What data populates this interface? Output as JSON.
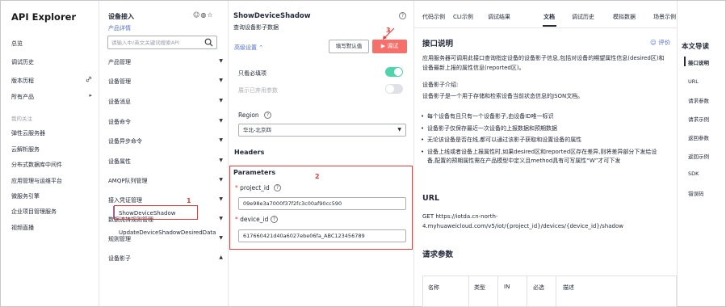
{
  "app": {
    "title": "API Explorer"
  },
  "left_nav": {
    "items": [
      {
        "label": "总览",
        "icon": ""
      },
      {
        "label": "调试历史",
        "icon": ""
      },
      {
        "label": "版本历程",
        "icon": "link-icon"
      },
      {
        "label": "所有产品",
        "icon": "chevron-right-icon"
      }
    ],
    "section_label": "我的关注",
    "followed": [
      "弹性云服务器",
      "云解析服务",
      "分布式数据库中间件",
      "应用管理与运维平台",
      "微服务引擎",
      "企业项目管理服务",
      "视频直播"
    ]
  },
  "api_list": {
    "title": "设备接入",
    "icons": [
      "smiley-icon",
      "globe-icon",
      "star-icon"
    ],
    "product_link": "产品详情",
    "search_placeholder": "请输入中/英文关键词搜索API",
    "groups": [
      "产品管理",
      "设备管理",
      "设备消息",
      "设备命令",
      "设备异步命令",
      "设备属性",
      "AMQP队列管理",
      "接入凭证管理",
      "数据流转规则管理",
      "规则管理",
      "设备影子"
    ],
    "sub_items": [
      "ShowDeviceShadow",
      "UpdateDeviceShadowDesiredData"
    ]
  },
  "debug_panel": {
    "api_name": "ShowDeviceShadow",
    "api_desc": "查询设备影子数据",
    "advanced_label": "高级设置",
    "fill_default_label": "填写默认值",
    "debug_label": "调试",
    "show_required_label": "只看必填项",
    "show_deprecated_label": "展示已弃用参数",
    "region_label": "Region",
    "region_value": "华北-北京四",
    "headers_label": "Headers",
    "parameters_label": "Parameters",
    "project_id_label": "project_id",
    "project_id_value": "09e98e3a7000f37f2fc3c00af90cc590",
    "device_id_label": "device_id",
    "device_id_value": "617660421d40a6027ebe06fa_ABC123456789",
    "show_required_on": true,
    "show_deprecated_on": false,
    "toggle_on_color": "#50d4ab",
    "toggle_off_color": "#dfe1e6",
    "debug_button_color": "#f66f6a",
    "annotations": [
      "1",
      "2",
      "3"
    ]
  },
  "doc_tabs": [
    "代码示例",
    "CLI示例",
    "调试结果",
    "文档",
    "调试历史",
    "模拟数据",
    "场景示例"
  ],
  "doc_active_tab": "文档",
  "doc": {
    "intro_heading": "接口说明",
    "rating_label": "评价",
    "intro_text": "应用服务器可调用此接口查询指定设备的设备影子信息,包括对设备的期望属性信息(desired区)和设备最新上报的属性信息(reported区)。",
    "shadow_intro_title": "设备影子介绍:",
    "shadow_intro_text": "设备影子是一个用于存储和检索设备当前状态信息的JSON文档。",
    "bullets": [
      "每个设备有且只有一个设备影子,由设备ID唯一标识",
      "设备影子仅保存最近一次设备的上报数据和预期数据",
      "无论该设备是否在线,都可以通过该影子获取和设置设备的属性",
      "设备上线或者设备上报属性时,如果desired区和reported区存在差异,则将差异部分下发给设备,配置的预期属性需在产品模型中定义且method具有可写属性“W”才可下发"
    ],
    "url_heading": "URL",
    "url_text": "GET  https://iotda.cn-north-4.myhuaweicloud.com/v5/iot/{project_id}/devices/{device_id}/shadow",
    "params_heading": "请求参数",
    "table_headers": [
      "名称",
      "类型",
      "IN",
      "必选",
      "描述"
    ]
  },
  "toc": {
    "title": "本文导读",
    "items": [
      "接口说明",
      "URL",
      "请求参数",
      "请求示例",
      "返回参数",
      "返回示例",
      "SDK",
      "错误码"
    ]
  }
}
